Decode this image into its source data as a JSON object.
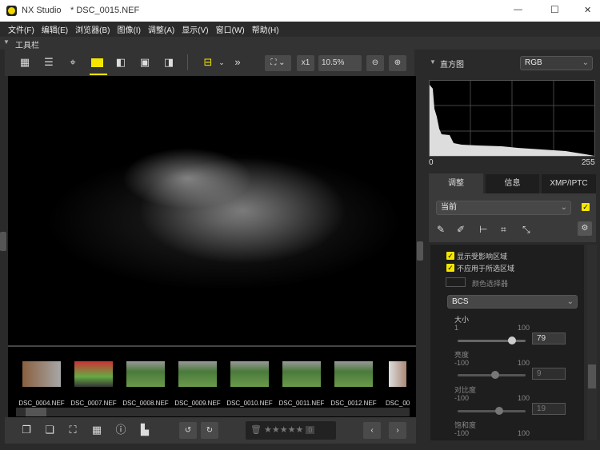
{
  "window": {
    "app": "NX Studio",
    "file": "* DSC_0015.NEF",
    "minimize": "—",
    "maximize": "☐",
    "close": "✕"
  },
  "menu": [
    "文件(F)",
    "编辑(E)",
    "浏览器(B)",
    "图像(I)",
    "调整(A)",
    "显示(V)",
    "窗口(W)",
    "帮助(H)"
  ],
  "toolbar": {
    "label": "工具栏",
    "zoom_value": "10.5%",
    "x1": "x1",
    "more": "»"
  },
  "filmstrip": {
    "files": [
      "DSC_0004.NEF",
      "DSC_0007.NEF",
      "DSC_0008.NEF",
      "DSC_0009.NEF",
      "DSC_0010.NEF",
      "DSC_0011.NEF",
      "DSC_0012.NEF",
      "DSC_00"
    ]
  },
  "bottom": {
    "rating_count": "0"
  },
  "histogram": {
    "title": "直方图",
    "channel": "RGB",
    "min": "0",
    "max": "255"
  },
  "tabs": [
    "调整",
    "信息",
    "XMP/IPTC"
  ],
  "adjust": {
    "preset": "当前",
    "show_affected": "显示受影响区域",
    "not_apply": "不应用于所选区域",
    "color_picker": "颜色选择器",
    "mode": "BCS",
    "sliders": [
      {
        "label": "大小",
        "min": "1",
        "max": "100",
        "value": "79",
        "pct": 79
      },
      {
        "label": "亮度",
        "min": "-100",
        "max": "100",
        "value": "9",
        "pct": 54
      },
      {
        "label": "对比度",
        "min": "-100",
        "max": "100",
        "value": "19",
        "pct": 59
      },
      {
        "label": "饱和度",
        "min": "-100",
        "max": "100"
      }
    ]
  },
  "colors": {
    "accent": "#f5e600"
  }
}
